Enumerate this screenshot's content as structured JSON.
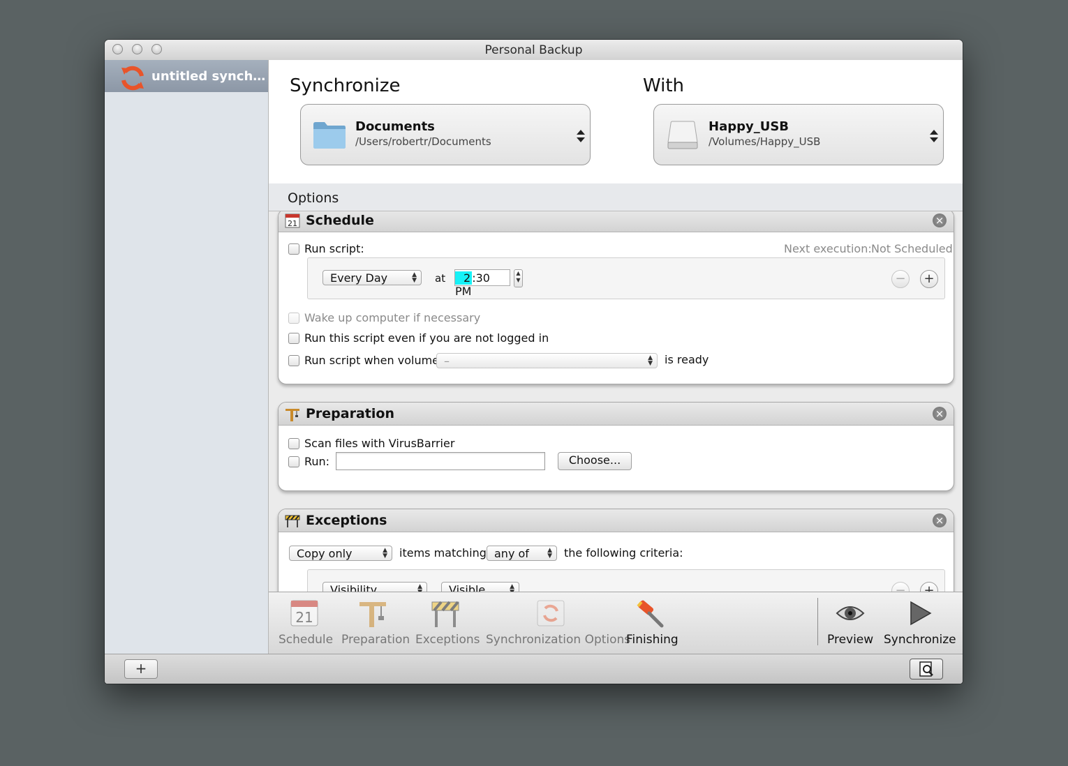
{
  "window": {
    "title": "Personal Backup"
  },
  "sidebar": {
    "items": [
      {
        "label": "untitled synch…"
      }
    ]
  },
  "source": {
    "heading": "Synchronize",
    "name": "Documents",
    "path": "/Users/robertr/Documents"
  },
  "target": {
    "heading": "With",
    "name": "Happy_USB",
    "path": "/Volumes/Happy_USB"
  },
  "options": {
    "label": "Options"
  },
  "schedule": {
    "title": "Schedule",
    "run_script_label": "Run script:",
    "next_execution_label": "Next execution:",
    "next_execution_value": "Not Scheduled",
    "frequency": "Every Day",
    "at_label": "at",
    "time_hour": "2",
    "time_rest": ":30  PM",
    "wake_label": "Wake up computer if necessary",
    "not_logged_label": "Run this script even if you are not logged in",
    "volume_label": "Run script when volume",
    "volume_value": "–",
    "ready_label": "is ready"
  },
  "preparation": {
    "title": "Preparation",
    "scan_label": "Scan files with VirusBarrier",
    "run_label": "Run:",
    "run_value": "",
    "choose_label": "Choose..."
  },
  "exceptions": {
    "title": "Exceptions",
    "mode": "Copy only",
    "items_matching_label": "items matching",
    "match": "any of",
    "criteria_label": "the following criteria:",
    "criteria_field": "Visibility",
    "criteria_value": "Visible"
  },
  "toolbar": {
    "schedule": "Schedule",
    "preparation": "Preparation",
    "exceptions": "Exceptions",
    "sync_options": "Synchronization Options",
    "finishing": "Finishing",
    "preview": "Preview",
    "synchronize": "Synchronize",
    "calendar_day": "21"
  },
  "bottom": {
    "add_label": "+"
  },
  "colors": {
    "time_highlight": "#17f2f7",
    "sidebar_selection": "#9aa5b3",
    "sync_icon": "#e8542a"
  }
}
